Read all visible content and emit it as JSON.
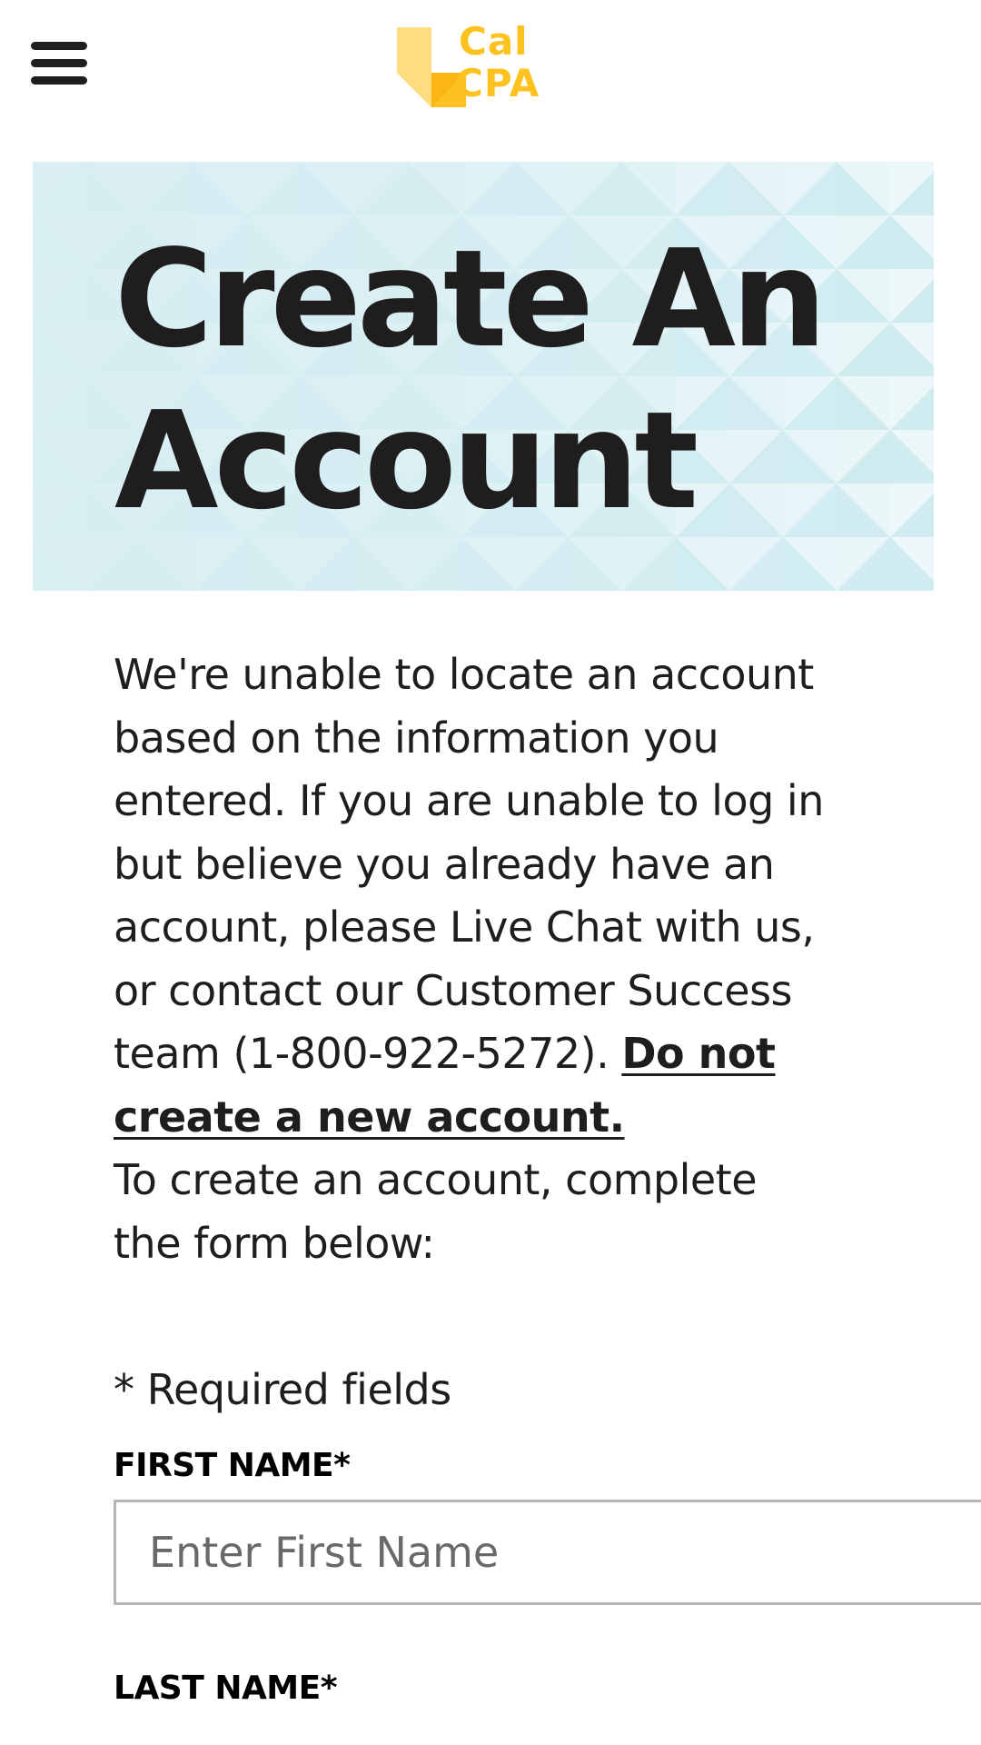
{
  "header": {
    "menu_icon": "hamburger-menu-icon",
    "logo": {
      "line1": "Cal",
      "line2": "CPA",
      "brand_color": "#fdc21f",
      "mark_colors": [
        "#fedc80",
        "#fdc21f"
      ]
    }
  },
  "hero": {
    "title_line1": "Create An",
    "title_line2": "Account",
    "background_color": "#d8eff3"
  },
  "content": {
    "intro_text": "We're unable to locate an account based on the information you entered. If you are unable to log in but believe you already have an account, please Live Chat with us, or contact our Customer Success team (1-800-922-5272).",
    "warning_link": "Do not create a new account.",
    "instruction": "To create an account, complete the form below:",
    "required_note": "* Required fields"
  },
  "form": {
    "first_name": {
      "label": "FIRST NAME*",
      "placeholder": "Enter First Name",
      "value": ""
    },
    "last_name": {
      "label": "LAST NAME*"
    }
  },
  "colors": {
    "text": "#1f1d1e",
    "input_border": "#b9b4b6"
  }
}
